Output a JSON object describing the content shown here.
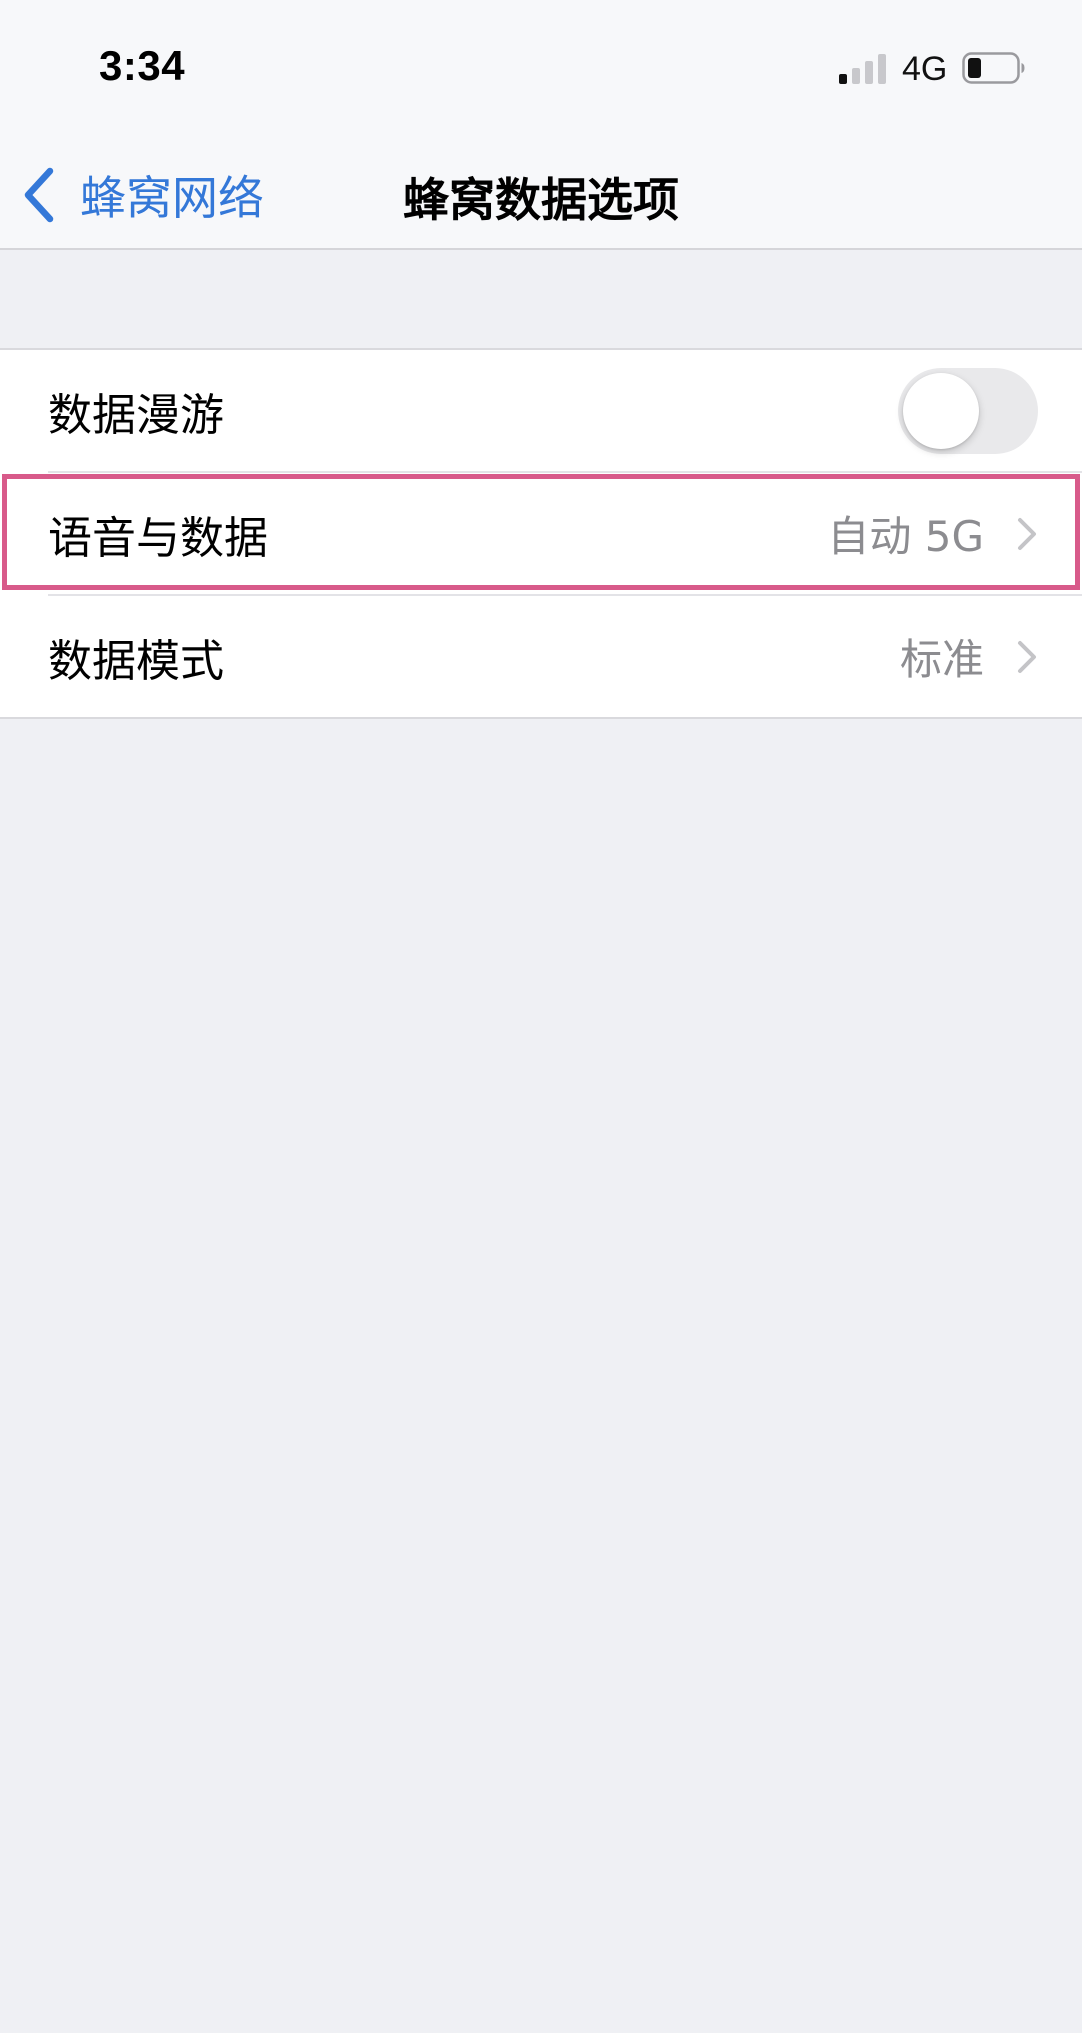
{
  "status_bar": {
    "time": "3:34",
    "network_type": "4G",
    "signal_icon": "cellular-signal-icon",
    "battery_icon": "battery-icon"
  },
  "nav": {
    "back_label": "蜂窝网络",
    "title": "蜂窝数据选项",
    "back_icon": "chevron-left-icon"
  },
  "settings": {
    "rows": [
      {
        "label": "数据漫游",
        "type": "toggle",
        "toggle_on": false
      },
      {
        "label": "语音与数据",
        "type": "disclosure",
        "value": "自动 5G"
      },
      {
        "label": "数据模式",
        "type": "disclosure",
        "value": "标准"
      }
    ]
  },
  "colors": {
    "accent": "#3478D8",
    "highlight_border": "#D85A8A",
    "background": "#EFF0F4",
    "secondary_text": "#8C8C90"
  }
}
